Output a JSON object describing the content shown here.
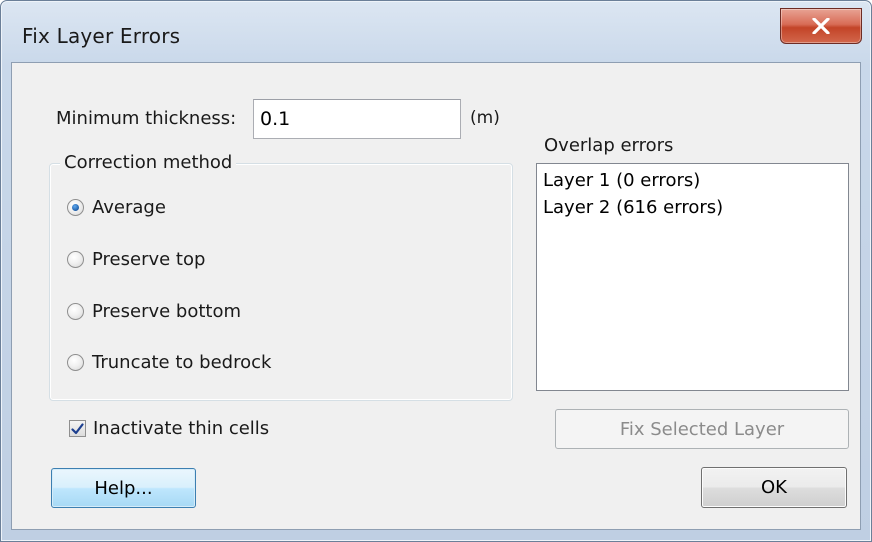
{
  "window": {
    "title": "Fix Layer Errors",
    "close_glyph": "X"
  },
  "thickness": {
    "label": "Minimum thickness:",
    "value": "0.1",
    "unit": "(m)"
  },
  "correction": {
    "group_title": "Correction method",
    "options": [
      {
        "label": "Average",
        "selected": true
      },
      {
        "label": "Preserve top",
        "selected": false
      },
      {
        "label": "Preserve bottom",
        "selected": false
      },
      {
        "label": "Truncate to bedrock",
        "selected": false
      }
    ]
  },
  "inactivate": {
    "label": "Inactivate thin cells",
    "checked": true
  },
  "overlap": {
    "label": "Overlap errors",
    "items": [
      "Layer 1 (0 errors)",
      "Layer 2 (616 errors)"
    ]
  },
  "buttons": {
    "fix_selected": "Fix Selected Layer",
    "help": "Help...",
    "ok": "OK"
  },
  "colors": {
    "accent": "#1f5ea8",
    "close_red": "#c34428",
    "disabled_text": "#8b8b8b"
  }
}
